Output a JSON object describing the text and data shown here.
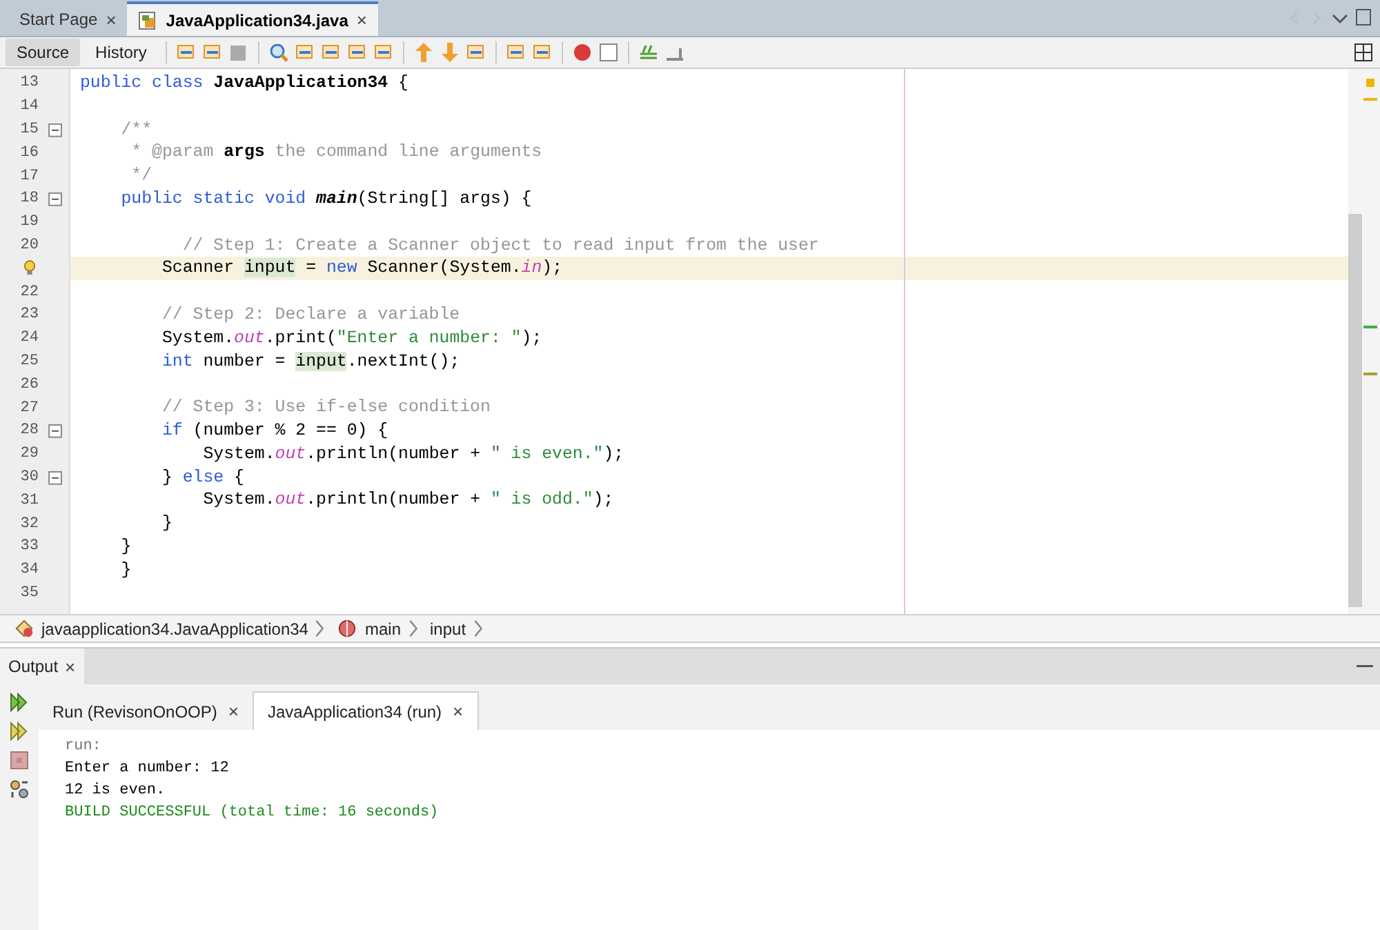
{
  "editor_tabs": [
    {
      "label": "Start Page",
      "close": "×",
      "selected": false
    },
    {
      "label": "JavaApplication34.java",
      "close": "×",
      "selected": true
    }
  ],
  "view_modes": [
    {
      "label": "Source",
      "selected": true
    },
    {
      "label": "History",
      "selected": false
    }
  ],
  "code_lines": [
    {
      "number": "13",
      "foldable": false,
      "current": false,
      "hint": false,
      "tokens": [
        {
          "t": "public class ",
          "kind": "keyword"
        },
        {
          "t": "JavaApplication34",
          "kind": "bold"
        },
        {
          "t": " {",
          "kind": "plain"
        }
      ]
    },
    {
      "number": "14",
      "foldable": false,
      "current": false,
      "hint": false
    },
    {
      "number": "15",
      "foldable": true,
      "current": false,
      "hint": false,
      "tokens": [
        {
          "t": "    /**",
          "kind": "comment"
        }
      ]
    },
    {
      "number": "16",
      "foldable": false,
      "current": false,
      "hint": false,
      "tokens": [
        {
          "t": "     * @param ",
          "kind": "comment"
        },
        {
          "t": "args",
          "kind": "bold"
        },
        {
          "t": " the command line arguments",
          "kind": "comment"
        }
      ]
    },
    {
      "number": "17",
      "foldable": false,
      "current": false,
      "hint": false,
      "tokens": [
        {
          "t": "     */",
          "kind": "comment"
        }
      ]
    },
    {
      "number": "18",
      "foldable": true,
      "current": false,
      "hint": false,
      "tokens": [
        {
          "t": "    public static void ",
          "kind": "keyword"
        },
        {
          "t": "main",
          "kind": "method"
        },
        {
          "t": "(String[] args) {",
          "kind": "plain"
        }
      ]
    },
    {
      "number": "19",
      "foldable": false,
      "current": false,
      "hint": false
    },
    {
      "number": "20",
      "foldable": false,
      "current": false,
      "hint": false,
      "tokens": [
        {
          "t": "          // Step 1: Create a Scanner object to read input from the user",
          "kind": "comment"
        }
      ]
    },
    {
      "foldable": false,
      "current": true,
      "hint": true,
      "tokens": [
        {
          "t": "        Scanner ",
          "kind": "plain"
        },
        {
          "t": "input",
          "kind": "usage"
        },
        {
          "t": " = ",
          "kind": "plain"
        },
        {
          "t": "new",
          "kind": "keyword"
        },
        {
          "t": " Scanner(System.",
          "kind": "plain"
        },
        {
          "t": "in",
          "kind": "field"
        },
        {
          "t": ");",
          "kind": "plain"
        }
      ]
    },
    {
      "number": "22",
      "foldable": false,
      "current": false,
      "hint": false
    },
    {
      "number": "23",
      "foldable": false,
      "current": false,
      "hint": false,
      "tokens": [
        {
          "t": "        // Step 2: Declare a variable",
          "kind": "comment"
        }
      ]
    },
    {
      "number": "24",
      "foldable": false,
      "current": false,
      "hint": false,
      "tokens": [
        {
          "t": "        System.",
          "kind": "plain"
        },
        {
          "t": "out",
          "kind": "field"
        },
        {
          "t": ".print(",
          "kind": "plain"
        },
        {
          "t": "\"Enter a number: \"",
          "kind": "string"
        },
        {
          "t": ");",
          "kind": "plain"
        }
      ]
    },
    {
      "number": "25",
      "foldable": false,
      "current": false,
      "hint": false,
      "tokens": [
        {
          "t": "        int",
          "kind": "keyword"
        },
        {
          "t": " number = ",
          "kind": "plain"
        },
        {
          "t": "input",
          "kind": "usage"
        },
        {
          "t": ".nextInt();",
          "kind": "plain"
        }
      ]
    },
    {
      "number": "26",
      "foldable": false,
      "current": false,
      "hint": false
    },
    {
      "number": "27",
      "foldable": false,
      "current": false,
      "hint": false,
      "tokens": [
        {
          "t": "        // Step 3: Use if-else condition",
          "kind": "comment"
        }
      ]
    },
    {
      "number": "28",
      "foldable": true,
      "current": false,
      "hint": false,
      "tokens": [
        {
          "t": "        if",
          "kind": "keyword"
        },
        {
          "t": " (number % 2 == 0) {",
          "kind": "plain"
        }
      ]
    },
    {
      "number": "29",
      "foldable": false,
      "current": false,
      "hint": false,
      "tokens": [
        {
          "t": "            System.",
          "kind": "plain"
        },
        {
          "t": "out",
          "kind": "field"
        },
        {
          "t": ".println(number + ",
          "kind": "plain"
        },
        {
          "t": "\" is even.\"",
          "kind": "string"
        },
        {
          "t": ");",
          "kind": "plain"
        }
      ]
    },
    {
      "number": "30",
      "foldable": true,
      "current": false,
      "hint": false,
      "tokens": [
        {
          "t": "        } ",
          "kind": "plain"
        },
        {
          "t": "else",
          "kind": "keyword"
        },
        {
          "t": " {",
          "kind": "plain"
        }
      ]
    },
    {
      "number": "31",
      "foldable": false,
      "current": false,
      "hint": false,
      "tokens": [
        {
          "t": "            System.",
          "kind": "plain"
        },
        {
          "t": "out",
          "kind": "field"
        },
        {
          "t": ".println(number + ",
          "kind": "plain"
        },
        {
          "t": "\" is odd.\"",
          "kind": "string"
        },
        {
          "t": ");",
          "kind": "plain"
        }
      ]
    },
    {
      "number": "32",
      "foldable": false,
      "current": false,
      "hint": false,
      "tokens": [
        {
          "t": "        }",
          "kind": "plain"
        }
      ]
    },
    {
      "number": "33",
      "foldable": false,
      "current": false,
      "hint": false,
      "tokens": [
        {
          "t": "    }",
          "kind": "plain"
        }
      ]
    },
    {
      "number": "34",
      "foldable": false,
      "current": false,
      "hint": false,
      "tokens": [
        {
          "t": "    }",
          "kind": "plain"
        }
      ]
    },
    {
      "number": "35",
      "foldable": false,
      "current": false,
      "hint": false
    }
  ],
  "breadcrumb": [
    {
      "label": "javaapplication34.JavaApplication34",
      "kind": "class"
    },
    {
      "label": "main",
      "kind": "method"
    },
    {
      "label": "input",
      "kind": "field"
    }
  ],
  "output": {
    "title": "Output",
    "close": "×",
    "tabs": [
      {
        "label": "Run (RevisonOnOOP)",
        "close": "×",
        "selected": false
      },
      {
        "label": "JavaApplication34 (run)",
        "close": "×",
        "selected": true
      }
    ],
    "lines": [
      {
        "text": "run:",
        "kind": "info"
      },
      {
        "text": "Enter a number: 12",
        "kind": "plain"
      },
      {
        "text": "12 is even.",
        "kind": "plain"
      },
      {
        "text": "BUILD SUCCESSFUL (total time: 16 seconds)",
        "kind": "success"
      }
    ]
  }
}
